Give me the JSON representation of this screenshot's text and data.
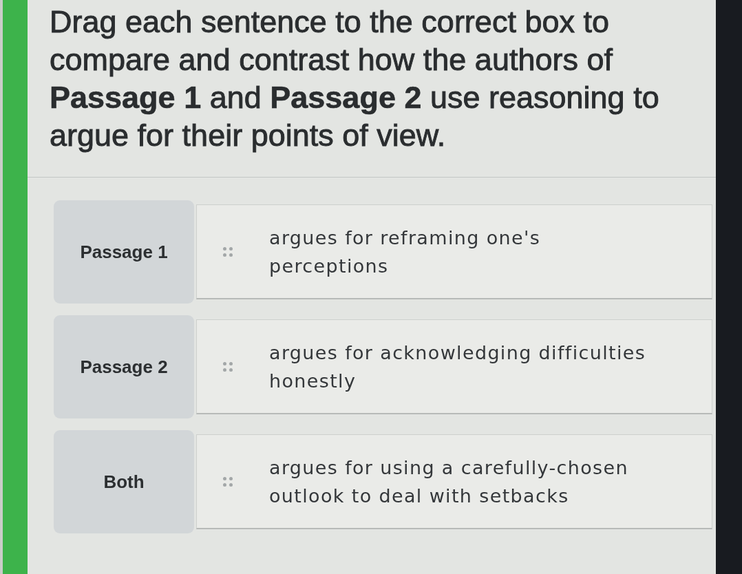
{
  "instruction": "Drag each sentence to the correct box to compare and contrast how the authors of **Passage 1** and **Passage 2** use reasoning to argue for their points of view.",
  "rows": [
    {
      "category": "Passage 1",
      "sentence": "argues for reframing one's perceptions"
    },
    {
      "category": "Passage 2",
      "sentence": "argues for acknowledging difficulties honestly"
    },
    {
      "category": "Both",
      "sentence": "argues for using a carefully-chosen outlook to deal with setbacks"
    }
  ]
}
